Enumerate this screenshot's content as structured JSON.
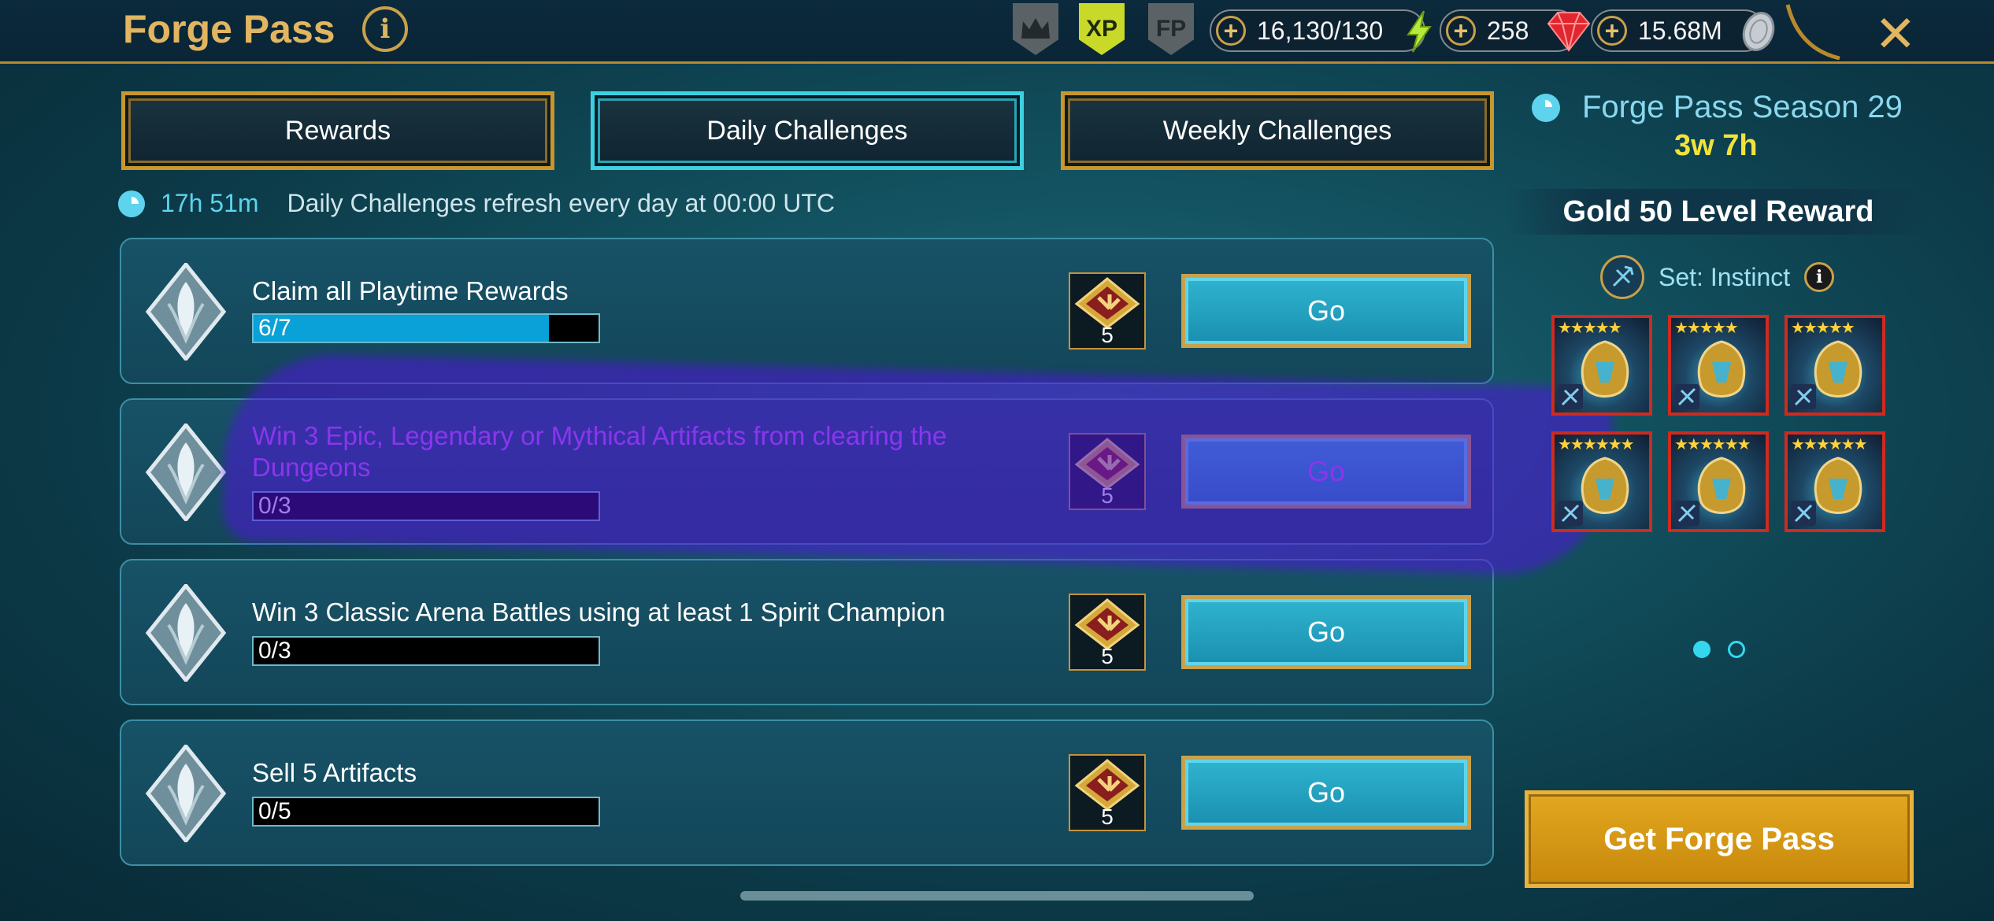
{
  "header": {
    "title": "Forge Pass",
    "info_icon": "info-icon",
    "badges": [
      {
        "icon": "crown-icon",
        "label": ""
      },
      {
        "icon": "xp-badge-icon",
        "label": "XP"
      },
      {
        "icon": "fp-badge-icon",
        "label": "FP"
      }
    ],
    "resources": [
      {
        "name": "energy",
        "value": "16,130/130",
        "icon": "lightning-icon"
      },
      {
        "name": "gems",
        "value": "258",
        "icon": "gem-icon"
      },
      {
        "name": "silver",
        "value": "15.68M",
        "icon": "silver-coin-icon"
      }
    ],
    "close_icon": "close-icon"
  },
  "tabs": [
    {
      "label": "Rewards",
      "active": false
    },
    {
      "label": "Daily Challenges",
      "active": true
    },
    {
      "label": "Weekly Challenges",
      "active": false
    }
  ],
  "refresh": {
    "timer": "17h 51m",
    "text": "Daily Challenges refresh every day at 00:00 UTC"
  },
  "challenges": [
    {
      "title": "Claim all Playtime Rewards",
      "progress_label": "6/7",
      "progress": 0.857,
      "reward_points": "5",
      "button": "Go"
    },
    {
      "title": "Win 3 Epic, Legendary or Mythical Artifacts from clearing the Dungeons",
      "progress_label": "0/3",
      "progress": 0,
      "reward_points": "5",
      "button": "Go"
    },
    {
      "title": "Win 3 Classic Arena Battles using at least 1 Spirit Champion",
      "progress_label": "0/3",
      "progress": 0,
      "reward_points": "5",
      "button": "Go"
    },
    {
      "title": "Sell 5 Artifacts",
      "progress_label": "0/5",
      "progress": 0,
      "reward_points": "5",
      "button": "Go"
    }
  ],
  "season": {
    "title": "Forge Pass Season 29",
    "time_left": "3w 7h"
  },
  "level_reward": {
    "title": "Gold 50 Level Reward",
    "set_label": "Set: Instinct",
    "items": [
      {
        "stars": 5,
        "icon": "weapon-artifact-icon"
      },
      {
        "stars": 5,
        "icon": "helmet-artifact-icon"
      },
      {
        "stars": 5,
        "icon": "shield-artifact-icon"
      },
      {
        "stars": 6,
        "icon": "gauntlets-artifact-icon"
      },
      {
        "stars": 6,
        "icon": "chestplate-artifact-icon"
      },
      {
        "stars": 6,
        "icon": "boots-artifact-icon"
      }
    ],
    "pages": 2,
    "current_page": 1
  },
  "buy_button": "Get Forge Pass",
  "colors": {
    "gold": "#c9962c",
    "active_tab": "#3fd0e0",
    "progress_fill": "#0aa0d8",
    "season_time": "#f2e23a",
    "highlight_text": "#d060ff"
  }
}
